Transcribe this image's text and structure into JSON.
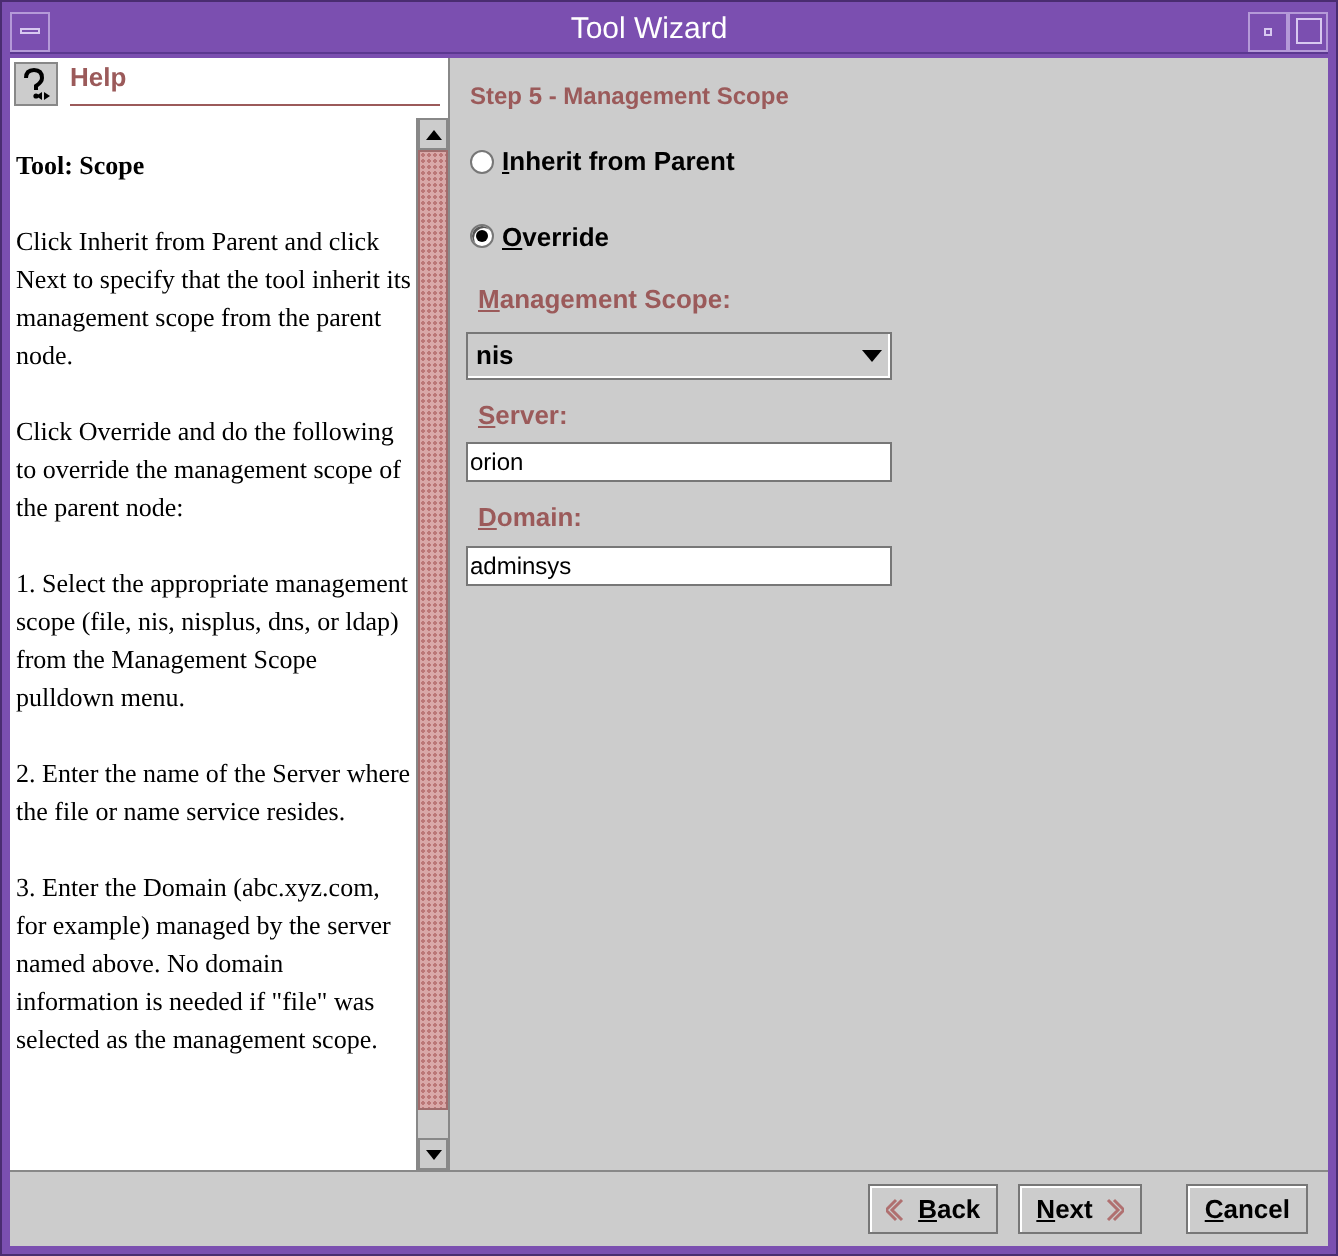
{
  "window": {
    "title": "Tool Wizard"
  },
  "help": {
    "heading": "Help",
    "title": "Tool: Scope",
    "paragraphs": [
      "Click Inherit from Parent and click Next to specify that the tool inherit its management scope from the parent node.",
      "Click Override and do the following to override the management scope of the parent node:",
      "1. Select the appropriate management scope (file, nis, nisplus, dns, or ldap) from the Management Scope pulldown menu.",
      "2. Enter the name of the Server where the file or name service resides.",
      "3. Enter the Domain (abc.xyz.com, for example) managed by the server named above. No domain information is needed if \"file\" was selected as the management scope."
    ]
  },
  "step": {
    "title": "Step 5 - Management Scope",
    "options": [
      {
        "label": "Inherit from Parent",
        "selected": false
      },
      {
        "label": "Override",
        "selected": true
      }
    ],
    "scope": {
      "label": "Management Scope:",
      "value": "nis"
    },
    "server": {
      "label": "Server:",
      "value": "orion"
    },
    "domain": {
      "label": "Domain:",
      "value": "adminsys"
    }
  },
  "buttons": [
    {
      "kind": "back",
      "label": "Back"
    },
    {
      "kind": "next",
      "label": "Next"
    },
    {
      "kind": "cancel",
      "label": "Cancel"
    }
  ]
}
